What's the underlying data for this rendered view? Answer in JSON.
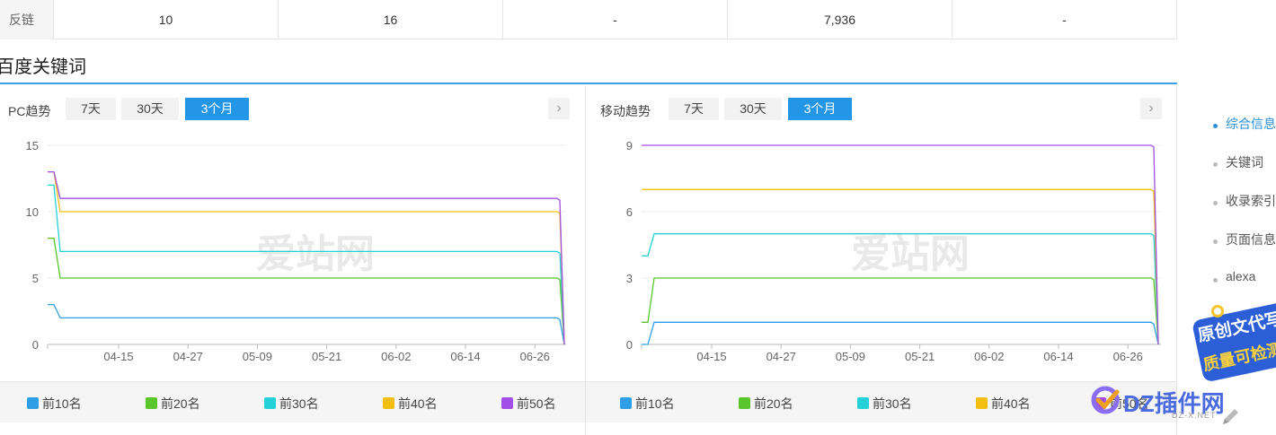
{
  "top_row": {
    "label": "反链",
    "values": [
      "10",
      "16",
      "-",
      "7,936",
      "-"
    ]
  },
  "section": {
    "title": "百度关键词"
  },
  "pc": {
    "title": "PC趋势",
    "ranges": [
      "7天",
      "30天",
      "3个月"
    ],
    "active_range": "3个月",
    "next_icon": "chevron-right-icon",
    "watermark": "爱站网"
  },
  "mobile": {
    "title": "移动趋势",
    "ranges": [
      "7天",
      "30天",
      "3个月"
    ],
    "active_range": "3个月",
    "next_icon": "chevron-right-icon",
    "watermark": "爱站网"
  },
  "legend": [
    {
      "label": "前10名",
      "color": "#2f9ee8"
    },
    {
      "label": "前20名",
      "color": "#5ac62b"
    },
    {
      "label": "前30名",
      "color": "#24d1d8"
    },
    {
      "label": "前40名",
      "color": "#f2bf10"
    },
    {
      "label": "前50名",
      "color": "#a14fe6"
    }
  ],
  "chart_data": [
    {
      "type": "line",
      "title": "PC趋势",
      "x_ticks": [
        "04-15",
        "04-27",
        "05-09",
        "05-21",
        "06-02",
        "06-14",
        "06-26"
      ],
      "ylim": [
        0,
        15
      ],
      "y_ticks": [
        "0",
        "5",
        "10",
        "15"
      ],
      "grid": true,
      "series": [
        {
          "name": "前10名",
          "color": "#2f9ee8",
          "start": [
            3,
            2
          ],
          "plateau": 2
        },
        {
          "name": "前20名",
          "color": "#5ac62b",
          "start": [
            8,
            5
          ],
          "plateau": 5
        },
        {
          "name": "前30名",
          "color": "#24d1d8",
          "start": [
            12,
            7
          ],
          "plateau": 7
        },
        {
          "name": "前40名",
          "color": "#f2bf10",
          "start": [
            13,
            10
          ],
          "plateau": 10
        },
        {
          "name": "前50名",
          "color": "#a14fe6",
          "start": [
            13,
            11
          ],
          "plateau": 11
        }
      ]
    },
    {
      "type": "line",
      "title": "移动趋势",
      "x_ticks": [
        "04-15",
        "04-27",
        "05-09",
        "05-21",
        "06-02",
        "06-14",
        "06-26"
      ],
      "ylim": [
        0,
        9
      ],
      "y_ticks": [
        "0",
        "3",
        "6",
        "9"
      ],
      "grid": true,
      "series": [
        {
          "name": "前10名",
          "color": "#2f9ee8",
          "start": [
            0,
            1
          ],
          "plateau": 1
        },
        {
          "name": "前20名",
          "color": "#5ac62b",
          "start": [
            1,
            3
          ],
          "plateau": 3
        },
        {
          "name": "前30名",
          "color": "#24d1d8",
          "start": [
            4,
            5
          ],
          "plateau": 5
        },
        {
          "name": "前40名",
          "color": "#f2bf10",
          "start": [
            7,
            7
          ],
          "plateau": 7
        },
        {
          "name": "前50名",
          "color": "#a14fe6",
          "start": [
            9,
            9
          ],
          "plateau": 9
        }
      ]
    }
  ],
  "side_nav": [
    {
      "label": "综合信息",
      "active": true
    },
    {
      "label": "关键词",
      "active": false
    },
    {
      "label": "收录索引",
      "active": false
    },
    {
      "label": "页面信息",
      "active": false
    },
    {
      "label": "alexa",
      "active": false
    }
  ],
  "promo": {
    "line1": "原创文代写",
    "line2": "质量可检测"
  },
  "site_watermark": {
    "name": "DZ插件网",
    "url": "DZ-X.NET"
  }
}
